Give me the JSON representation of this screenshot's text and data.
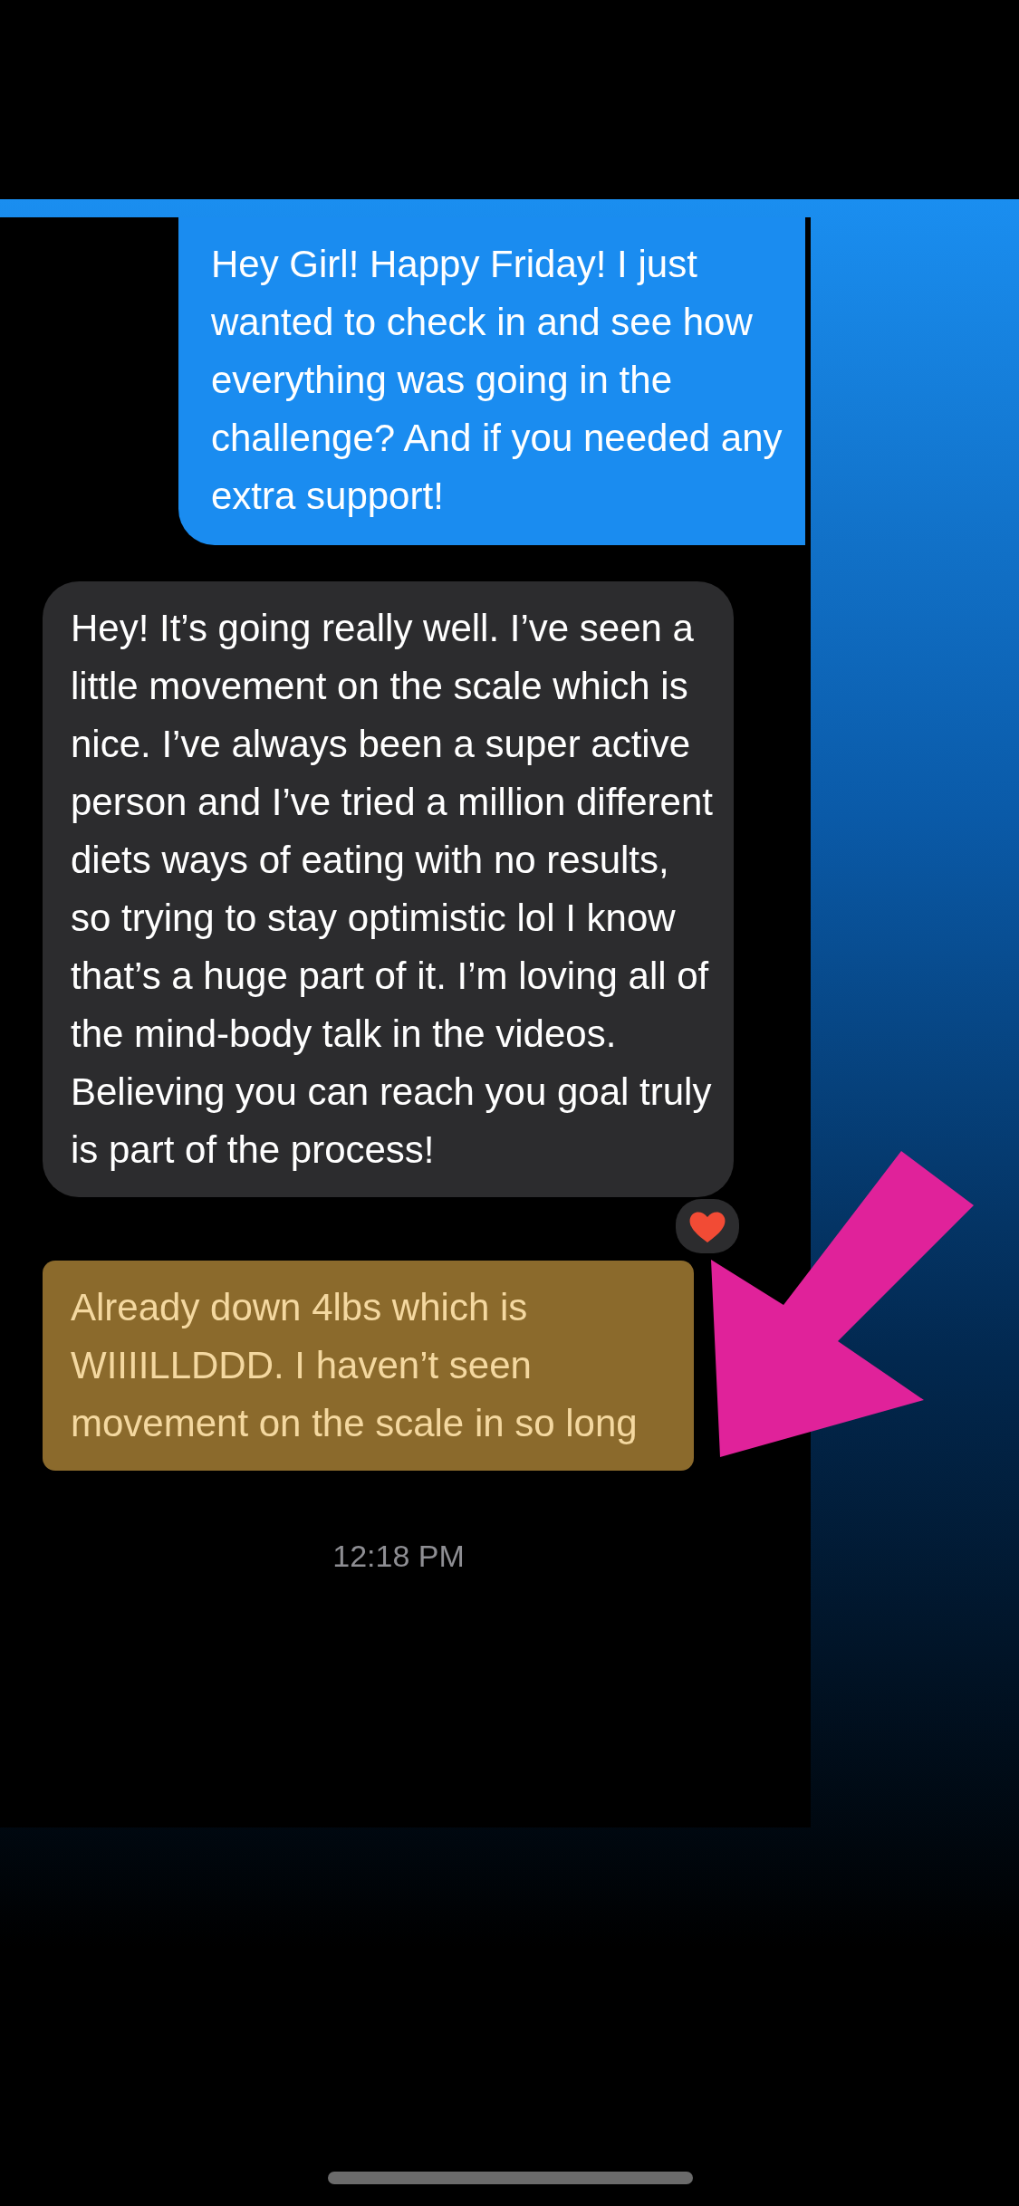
{
  "messages": [
    {
      "kind": "sent",
      "text": "Hey Girl! Happy Friday! I just wanted to check in and see how everything was going in the challenge? And if you needed any extra support!",
      "reacted": false,
      "highlighted": false
    },
    {
      "kind": "received",
      "text": "Hey! It’s going really well. I’ve seen a little movement on the scale which is nice. I’ve always been a super active person and I’ve tried a million different diets ways of eating with no results, so trying to stay optimistic lol I know that’s a huge part of it. I’m loving all of the mind-body talk in the videos. Believing you can reach you goal truly is part of the process!",
      "reacted": true,
      "highlighted": false
    },
    {
      "kind": "received",
      "text": "Already down 4lbs which is WIIIILLDDD. I haven’t seen movement on the scale in so long",
      "reacted": false,
      "highlighted": true
    }
  ],
  "timestamp": "12:18 PM"
}
